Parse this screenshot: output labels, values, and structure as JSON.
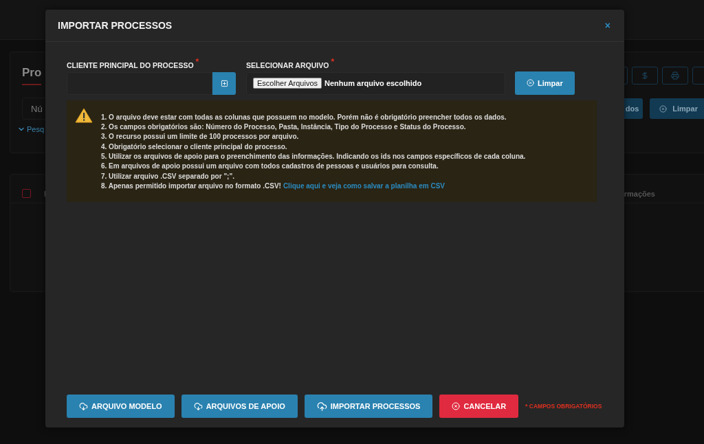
{
  "background": {
    "page_title": "Pro",
    "search_placeholder": "Nú",
    "search_toggle": "Pesq",
    "filter_buttons": [
      {
        "label": "dos",
        "kind": "plain"
      },
      {
        "label": "Limpar",
        "kind": "clear"
      }
    ],
    "select_all": {
      "checked": false
    },
    "table": {
      "columns": [
        "I",
        "rmações"
      ]
    }
  },
  "modal": {
    "title": "IMPORTAR PROCESSOS",
    "close": "×",
    "client_field": {
      "label": "CLIENTE PRINCIPAL DO PROCESSO",
      "required_mark": "*"
    },
    "file_field": {
      "label": "SELECIONAR ARQUIVO",
      "required_mark": "*",
      "button": "Escolher Arquivos",
      "status": "Nenhum arquivo escolhido"
    },
    "clear_button": "Limpar",
    "notes": [
      {
        "text": "1. O arquivo deve estar com todas as colunas que possuem no modelo. Porém não é obrigatório preencher todos os dados."
      },
      {
        "text": "2. Os campos obrigatórios são: Número do Processo, Pasta, Instância, Tipo do Processo e Status do Processo."
      },
      {
        "text": "3. O recurso possui um limite de 100 processos por arquivo."
      },
      {
        "text": "4. Obrigatório selecionar o cliente principal do processo."
      },
      {
        "text": "5. Utilizar os arquivos de apoio para o preenchimento das informações. Indicando os ids nos campos específicos de cada coluna."
      },
      {
        "text": "6. Em arquivos de apoio possui um arquivo com todos cadastros de pessoas e usuários para consulta."
      },
      {
        "text": "7. Utilizar arquivo .CSV separado por \";\"."
      },
      {
        "text": "8. Apenas permitido importar arquivo no formato .CSV!",
        "link": "Clique aqui e veja como salvar a planilha em CSV"
      }
    ],
    "footer_buttons": [
      {
        "label": "ARQUIVO MODELO",
        "kind": "download"
      },
      {
        "label": "ARQUIVOS DE APOIO",
        "kind": "download"
      },
      {
        "label": "IMPORTAR PROCESSOS",
        "kind": "upload"
      },
      {
        "label": "CANCELAR",
        "kind": "cancel"
      }
    ],
    "required_note": "* CAMPOS OBRIGATÓRIOS"
  }
}
